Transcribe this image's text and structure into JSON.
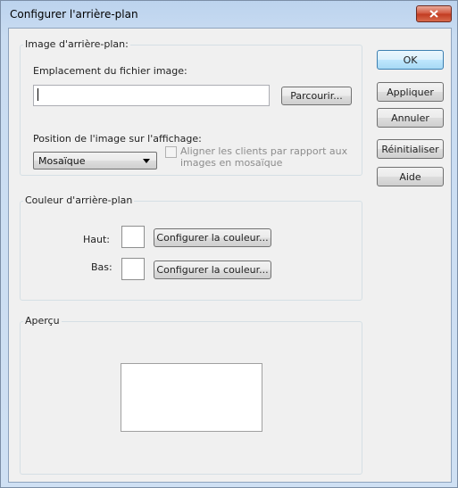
{
  "window": {
    "title": "Configurer l'arrière-plan",
    "close_icon": "close-icon"
  },
  "image_group": {
    "label": "Image d'arrière-plan:",
    "file_location_label": "Emplacement du fichier image:",
    "file_location_value": "",
    "browse_button": "Parcourir...",
    "position_label": "Position de l'image sur l'affichage:",
    "position_selected": "Mosaïque",
    "align_checkbox_label": "Aligner les clients par rapport aux images en mosaïque",
    "align_checked": false
  },
  "color_group": {
    "label": "Couleur d'arrière-plan",
    "top_label": "Haut:",
    "top_color": "#ffffff",
    "top_button": "Configurer la couleur...",
    "bottom_label": "Bas:",
    "bottom_color": "#ffffff",
    "bottom_button": "Configurer la couleur..."
  },
  "preview_group": {
    "label": "Aperçu"
  },
  "buttons": {
    "ok": "OK",
    "apply": "Appliquer",
    "cancel": "Annuler",
    "reset": "Réinitialiser",
    "help": "Aide"
  }
}
